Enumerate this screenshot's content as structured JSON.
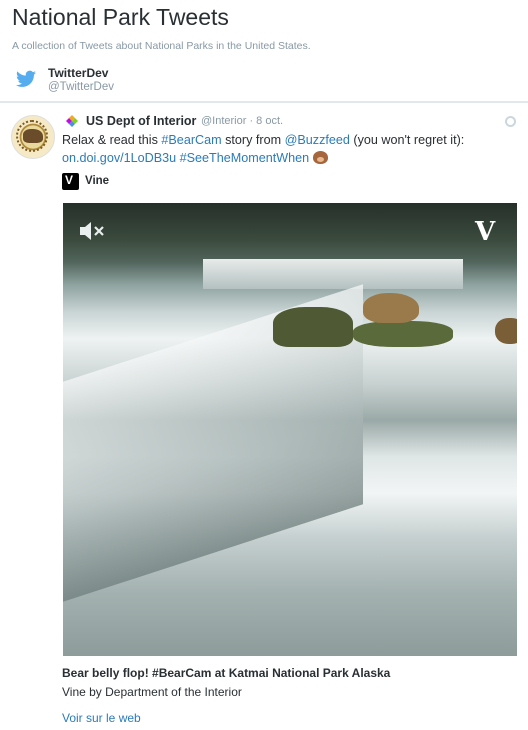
{
  "header": {
    "title": "National Park Tweets",
    "description": "A collection of Tweets about National Parks in the United States.",
    "curator_name": "TwitterDev",
    "curator_handle": "@TwitterDev"
  },
  "tweet": {
    "author_name": "US Dept of Interior",
    "author_meta": "@Interior · 8 oct.",
    "text": {
      "part1": "Relax & read this ",
      "hashtag1": "#BearCam",
      "part2": " story from ",
      "mention": "@Buzzfeed",
      "part3": " (you won't regret it):",
      "url": "on.doi.gov/1LoDB3u",
      "hashtag2": "#SeeTheMomentWhen"
    },
    "source_label": "Vine",
    "card": {
      "title": "Bear belly flop! #BearCam at Katmai National Park Alaska",
      "subtitle": "Vine by Department of the Interior",
      "link": "Voir sur le web"
    }
  },
  "colors": {
    "link": "#2b7bb9",
    "muted": "#8899a6",
    "text": "#292f33",
    "twitter_blue": "#55acee"
  },
  "icons": [
    "twitter-bird-icon",
    "pin-icon",
    "twitter-logo-icon",
    "vine-logo-icon",
    "bear-emoji-icon",
    "mute-icon",
    "vine-v-icon"
  ]
}
